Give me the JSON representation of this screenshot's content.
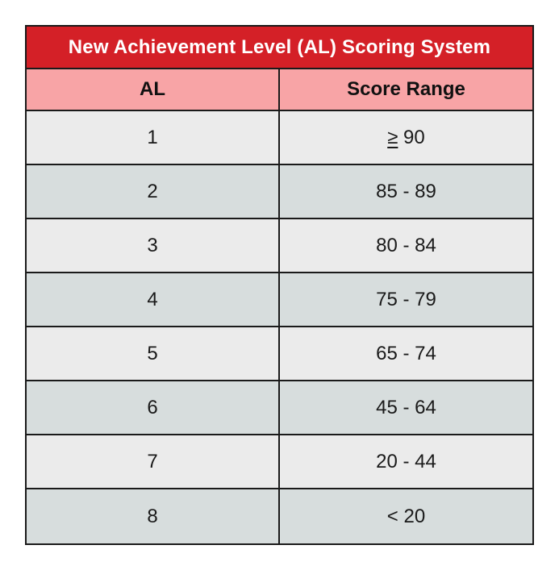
{
  "title": "New Achievement Level (AL) Scoring System",
  "colors": {
    "title_bg": "#d42027",
    "header_bg": "#f8a4a6",
    "row_light": "#ebebeb",
    "row_dark": "#d7dddd"
  },
  "headers": [
    "AL",
    "Score Range"
  ],
  "rows": [
    {
      "al": "1",
      "range_symbol": "≥",
      "range": " 90"
    },
    {
      "al": "2",
      "range": "85 - 89"
    },
    {
      "al": "3",
      "range": "80 - 84"
    },
    {
      "al": "4",
      "range": "75 - 79"
    },
    {
      "al": "5",
      "range": "65 - 74"
    },
    {
      "al": "6",
      "range": "45 - 64"
    },
    {
      "al": "7",
      "range": "20 - 44"
    },
    {
      "al": "8",
      "range": "< 20"
    }
  ]
}
